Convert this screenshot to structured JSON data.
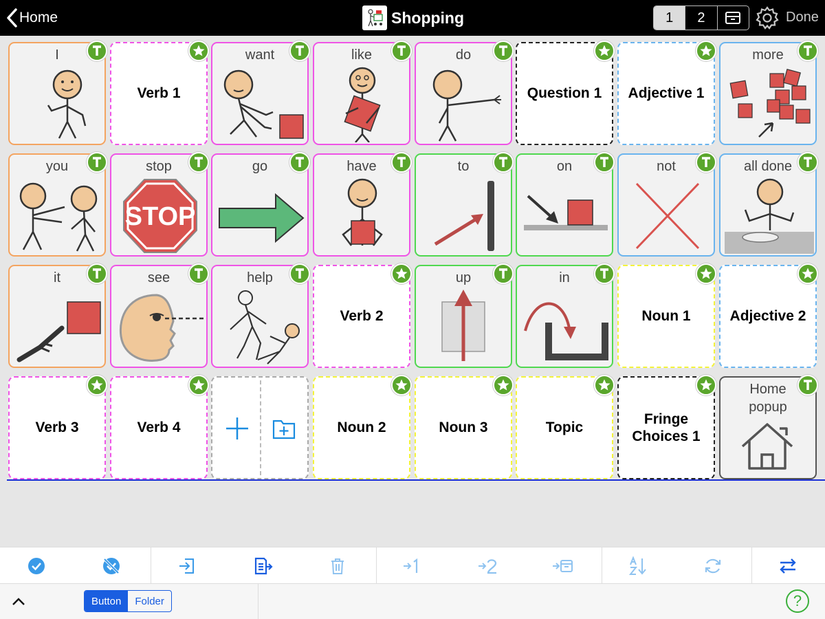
{
  "header": {
    "back_label": "Home",
    "title": "Shopping",
    "pages": [
      "1",
      "2"
    ],
    "active_page": "1",
    "done_label": "Done"
  },
  "grid": {
    "row1": [
      "I",
      "Verb 1",
      "want",
      "like",
      "do",
      "Question 1",
      "Adjective 1",
      "more"
    ],
    "row2": [
      "you",
      "stop",
      "go",
      "have",
      "to",
      "on",
      "not",
      "all done"
    ],
    "row3": [
      "it",
      "see",
      "help",
      "Verb 2",
      "up",
      "in",
      "Noun 1",
      "Adjective 2"
    ],
    "row4": [
      "Verb 3",
      "Verb 4",
      "",
      "Noun 2",
      "Noun 3",
      "Topic",
      "Fringe Choices 1",
      "Home popup"
    ],
    "stop_sign_text": "STOP"
  },
  "bottombar": {
    "seg_button": "Button",
    "seg_folder": "Folder",
    "help": "?"
  },
  "colors": {
    "pronoun": "#f4a460",
    "verb": "#ef54e6",
    "preposition": "#4fd84f",
    "adjective": "#6ab4ee",
    "noun": "#f3f33a",
    "badge": "#5aa62c",
    "accent": "#1a5ee0"
  },
  "icons": {
    "toolbar": [
      "check-circle-icon",
      "deselect-icon",
      "import-icon",
      "copy-paste-icon",
      "trash-icon",
      "move-to-page-1-icon",
      "move-to-page-2-icon",
      "move-to-archive-icon",
      "sort-az-icon",
      "refresh-icon",
      "swap-icon"
    ],
    "badges": [
      "text-badge-icon",
      "folder-star-badge-icon"
    ]
  }
}
